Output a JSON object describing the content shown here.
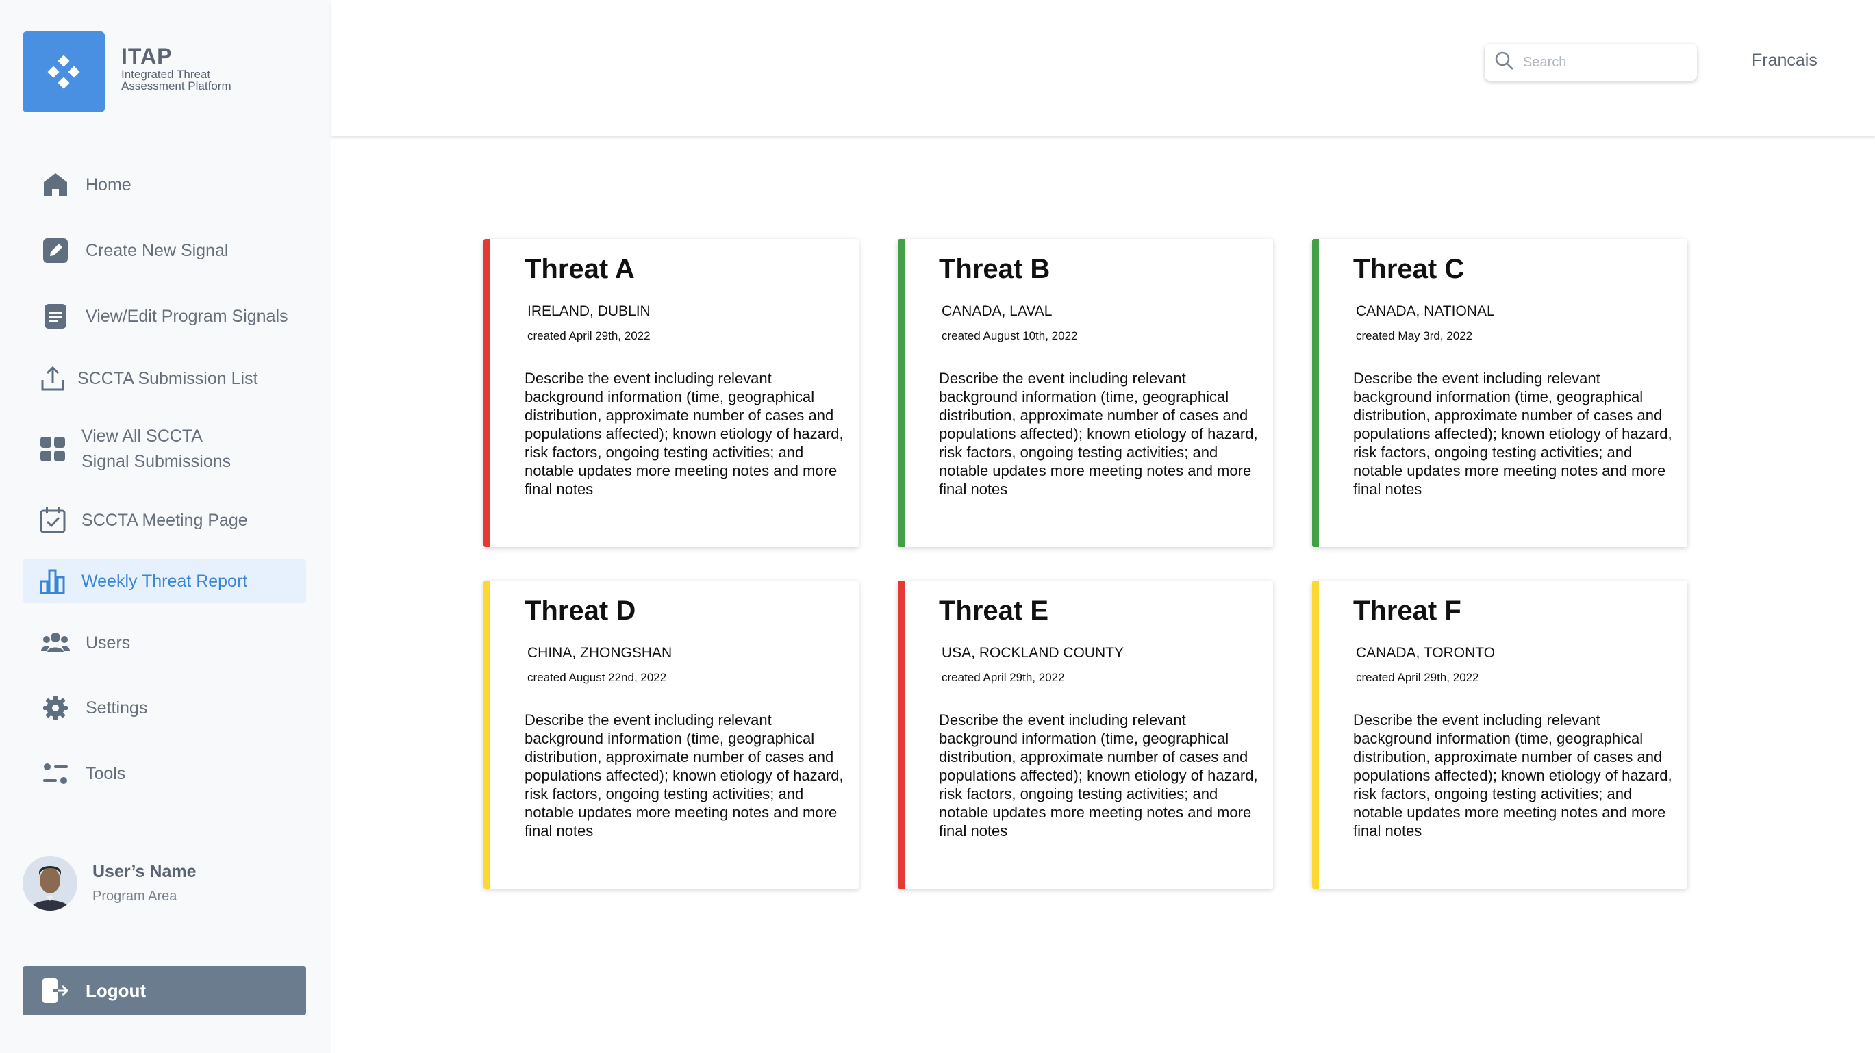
{
  "app": {
    "name": "ITAP",
    "subtitle_line1": "Integrated Threat",
    "subtitle_line2": "Assessment Platform"
  },
  "sidebar": {
    "items": [
      {
        "label": "Home",
        "icon": "home-icon"
      },
      {
        "label": "Create New Signal",
        "icon": "edit-icon"
      },
      {
        "label": "View/Edit Program Signals",
        "icon": "document-icon"
      },
      {
        "label": "SCCTA Submission List",
        "icon": "upload-icon"
      },
      {
        "label_line1": "View All SCCTA",
        "label_line2": "Signal Submissions",
        "icon": "grid-icon"
      },
      {
        "label": "SCCTA Meeting Page",
        "icon": "calendar-check-icon"
      },
      {
        "label": "Weekly Threat Report",
        "icon": "bar-chart-icon",
        "active": true
      },
      {
        "label": "Users",
        "icon": "users-icon"
      },
      {
        "label": "Settings",
        "icon": "gear-icon"
      },
      {
        "label": "Tools",
        "icon": "tools-icon"
      }
    ],
    "user": {
      "name": "User’s Name",
      "area": "Program Area"
    },
    "logout_label": "Logout"
  },
  "header": {
    "search_placeholder": "Search",
    "language_label": "Francais"
  },
  "colors": {
    "accent": "#4a90e2",
    "red": "#e53935",
    "green": "#43a047",
    "yellow": "#fdd835"
  },
  "threats": [
    {
      "title": "Threat A",
      "location": "IRELAND, DUBLIN",
      "created": "created April 29th, 2022",
      "status_color": "#e53935",
      "description": "Describe the event including relevant background information (time, geographical distribution, approximate number of cases and populations affected); known etiology of hazard, risk factors, ongoing testing activities; and notable updates more meeting notes and more final notes"
    },
    {
      "title": "Threat B",
      "location": "CANADA, LAVAL",
      "created": "created August 10th, 2022",
      "status_color": "#43a047",
      "description": "Describe the event including relevant background information (time, geographical distribution, approximate number of cases and populations affected); known etiology of hazard, risk factors, ongoing testing activities; and notable updates more meeting notes and more final notes"
    },
    {
      "title": "Threat C",
      "location": "CANADA, NATIONAL",
      "created": "created May 3rd, 2022",
      "status_color": "#43a047",
      "description": "Describe the event including relevant background information (time, geographical distribution, approximate number of cases and populations affected); known etiology of hazard, risk factors, ongoing testing activities; and notable updates more meeting notes and more final notes"
    },
    {
      "title": "Threat D",
      "location": "CHINA, ZHONGSHAN",
      "created": "created August 22nd, 2022",
      "status_color": "#fdd835",
      "description": "Describe the event including relevant background information (time, geographical distribution, approximate number of cases and populations affected); known etiology of hazard, risk factors, ongoing testing activities; and notable updates more meeting notes and more final notes"
    },
    {
      "title": "Threat E",
      "location": "USA, ROCKLAND COUNTY",
      "created": "created April 29th, 2022",
      "status_color": "#e53935",
      "description": "Describe the event including relevant background information (time, geographical distribution, approximate number of cases and populations affected); known etiology of hazard, risk factors, ongoing testing activities; and notable updates more meeting notes and more final notes"
    },
    {
      "title": "Threat F",
      "location": "CANADA, TORONTO",
      "created": "created April 29th, 2022",
      "status_color": "#fdd835",
      "description": "Describe the event including relevant background information (time, geographical distribution, approximate number of cases and populations affected); known etiology of hazard, risk factors, ongoing testing activities; and notable updates more meeting notes and more final notes"
    }
  ]
}
